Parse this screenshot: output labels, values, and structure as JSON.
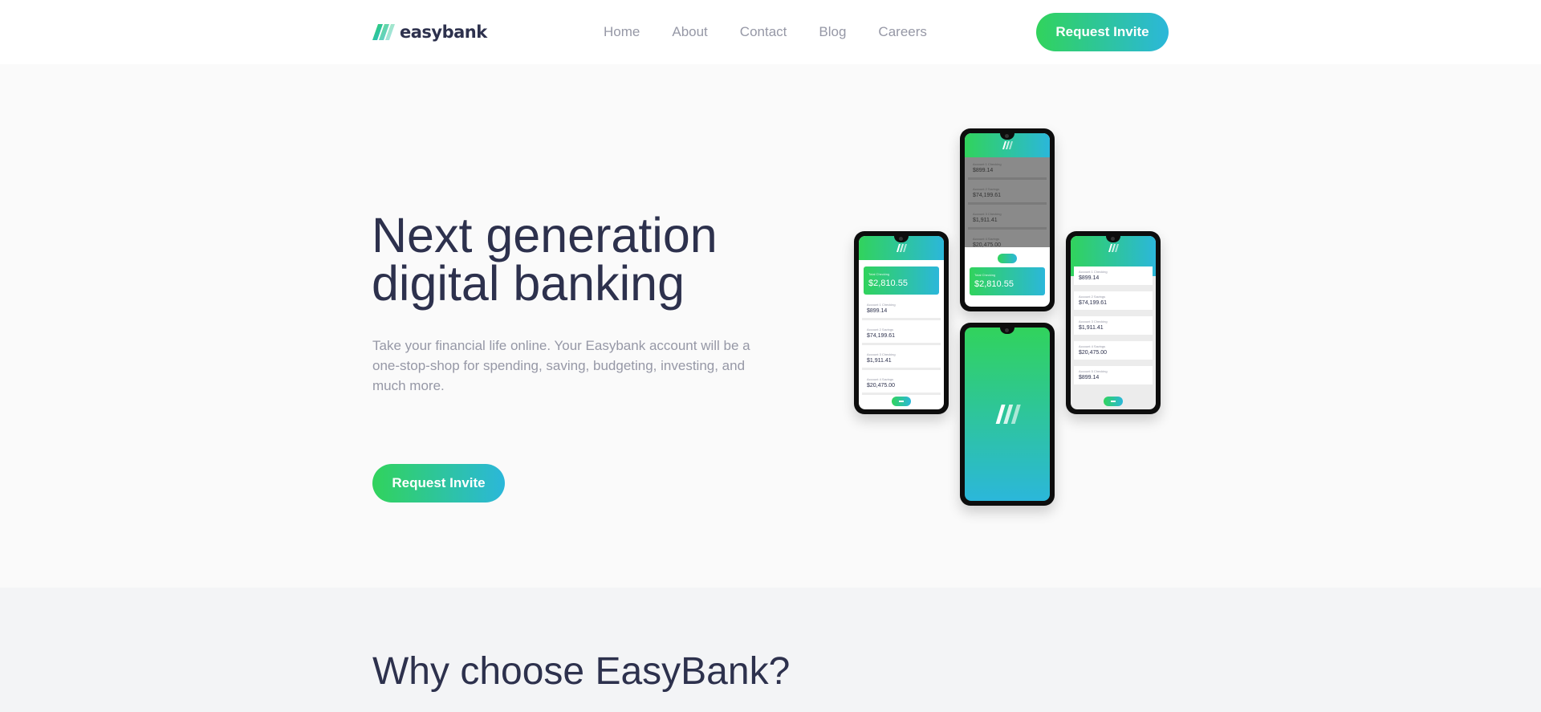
{
  "brand": {
    "name": "easybank",
    "accent_green": "#31d35c",
    "accent_cyan": "#2bb7da",
    "dark": "#2d314d",
    "grey": "#9698a6"
  },
  "header": {
    "logo_icon": "easybank-logo-icon",
    "nav": [
      {
        "label": "Home"
      },
      {
        "label": "About"
      },
      {
        "label": "Contact"
      },
      {
        "label": "Blog"
      },
      {
        "label": "Careers"
      }
    ],
    "cta_label": "Request Invite"
  },
  "hero": {
    "title": "Next generation digital banking",
    "text": "Take your financial life online. Your Easybank account will be a one-stop-shop for spending, saving, budgeting, investing, and much more.",
    "cta_label": "Request Invite",
    "mockups": {
      "total_label": "Total Checking",
      "total_value": "$2,810.55",
      "accounts": [
        {
          "label": "Account 1 Checking",
          "value": "$899.14"
        },
        {
          "label": "Account 2 Savings",
          "value": "$74,199.61"
        },
        {
          "label": "Account 3 Checking",
          "value": "$1,911.41"
        },
        {
          "label": "Account 4 Savings",
          "value": "$20,475.00"
        },
        {
          "label": "Account 5 Checking",
          "value": "$899.14"
        }
      ]
    }
  },
  "why": {
    "title": "Why choose EasyBank?"
  }
}
